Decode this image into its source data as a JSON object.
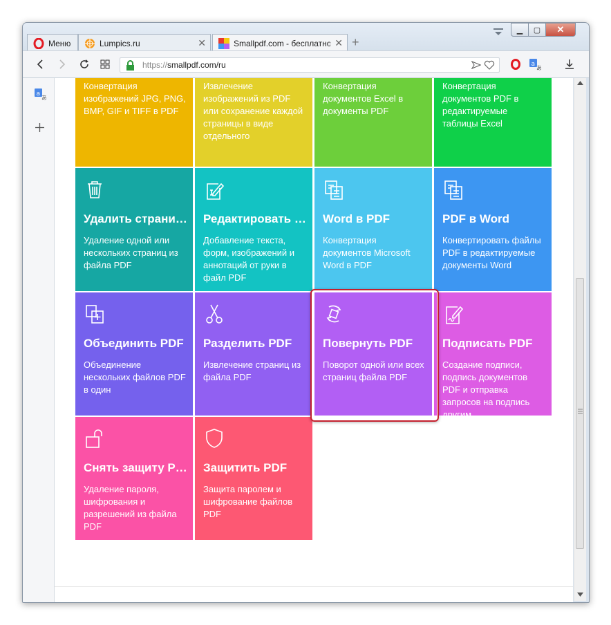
{
  "browser": {
    "tabs": [
      {
        "label": "Меню",
        "icon": "opera-logo-icon"
      },
      {
        "label": "Lumpics.ru",
        "icon": "lumpics-favicon-icon"
      },
      {
        "label": "Smallpdf.com - бесплатно",
        "icon": "smallpdf-favicon-icon",
        "active": true
      }
    ],
    "url_scheme": "https://",
    "url_host": "smallpdf.com/ru",
    "colors": {
      "accent_highlight": "#c4202e",
      "lock_green": "#2e9a3c"
    }
  },
  "tiles": [
    {
      "id": "jpg-to-pdf",
      "color": "#eeb600",
      "desc": "Конвертация изображений JPG, PNG, BMP, GIF и TIFF в PDF"
    },
    {
      "id": "pdf-to-jpg",
      "color": "#e3d02a",
      "desc": "Извлечение изображений из PDF или сохранение каждой страницы в виде отдельного"
    },
    {
      "id": "excel-to-pdf",
      "color": "#6dcf3b",
      "desc": "Конвертация документов Excel в документы PDF"
    },
    {
      "id": "pdf-to-excel",
      "color": "#0fd049",
      "desc": "Конвертация документов PDF в редактируемые таблицы Excel"
    },
    {
      "id": "delete-pages",
      "color": "#16a7a3",
      "icon": "trash-icon",
      "title": "Удалить страницы",
      "desc": "Удаление одной или нескольких страниц из файла PDF"
    },
    {
      "id": "edit-pdf",
      "color": "#13c3c3",
      "icon": "edit-document-icon",
      "title": "Редактировать PDF",
      "desc": "Добавление текста, форм, изображений и аннотаций от руки в файл PDF"
    },
    {
      "id": "word-to-pdf",
      "color": "#4cc6ef",
      "icon": "document-stack-icon",
      "title": "Word в PDF",
      "desc": "Конвертация документов Microsoft Word в PDF"
    },
    {
      "id": "pdf-to-word",
      "color": "#3d96f2",
      "icon": "document-stack-icon",
      "title": "PDF в Word",
      "desc": "Конвертировать файлы PDF в редактируемые документы Word"
    },
    {
      "id": "merge-pdf",
      "color": "#7561ed",
      "icon": "merge-icon",
      "title": "Объединить PDF",
      "desc": "Объединение нескольких файлов PDF в один"
    },
    {
      "id": "split-pdf",
      "color": "#9160f2",
      "icon": "scissors-icon",
      "title": "Разделить PDF",
      "desc": "Извлечение страниц из файла PDF"
    },
    {
      "id": "rotate-pdf",
      "color": "#b25ff4",
      "icon": "rotate-icon",
      "title": "Повернуть PDF",
      "desc": "Поворот одной или всех страниц файла PDF"
    },
    {
      "id": "sign-pdf",
      "color": "#dd5ce4",
      "icon": "signature-icon",
      "title": "Подписать PDF",
      "desc": "Создание подписи, подпись документов PDF и отправка запросов на подпись другим"
    },
    {
      "id": "unlock-pdf",
      "color": "#fb52a6",
      "icon": "unlock-icon",
      "title": "Снять защиту PDF",
      "desc": "Удаление пароля, шифрования и разрешений из файла PDF"
    },
    {
      "id": "protect-pdf",
      "color": "#fd5873",
      "icon": "shield-icon",
      "title": "Защитить PDF",
      "desc": "Защита паролем и шифрование файлов PDF"
    }
  ]
}
